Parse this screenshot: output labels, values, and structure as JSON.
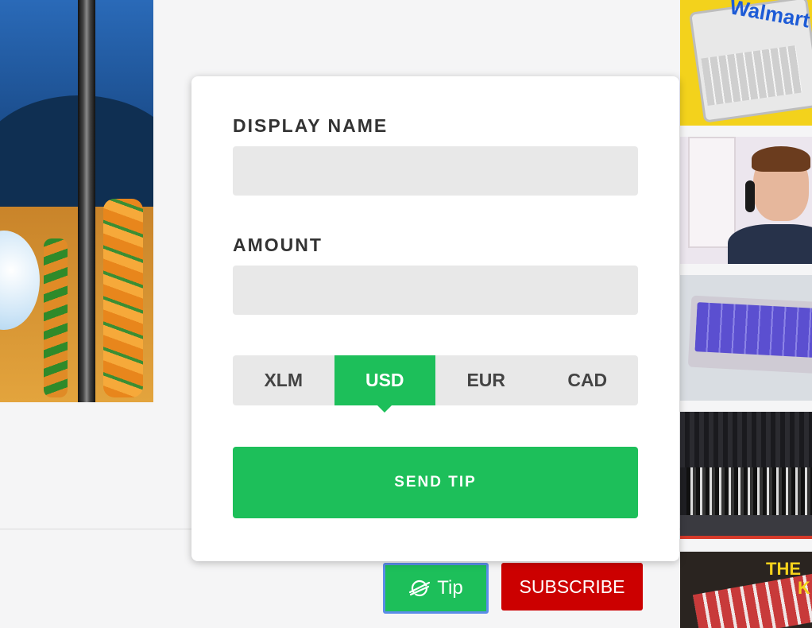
{
  "tip_form": {
    "display_name_label": "DISPLAY NAME",
    "display_name_value": "",
    "amount_label": "AMOUNT",
    "amount_value": "",
    "currencies": [
      {
        "code": "XLM",
        "selected": false
      },
      {
        "code": "USD",
        "selected": true
      },
      {
        "code": "EUR",
        "selected": false
      },
      {
        "code": "CAD",
        "selected": false
      }
    ],
    "send_label": "SEND TIP"
  },
  "channel_actions": {
    "tip_label": "Tip",
    "tip_icon": "stellar-icon",
    "subscribe_label": "SUBSCRIBE"
  },
  "recommendations": {
    "first_thumbnail_text": "Walmart",
    "last_thumbnail_text": [
      "THE",
      "K"
    ]
  },
  "colors": {
    "accent_green": "#1dbf5a",
    "subscribe_red": "#cc0000",
    "field_gray": "#e8e8e8"
  }
}
